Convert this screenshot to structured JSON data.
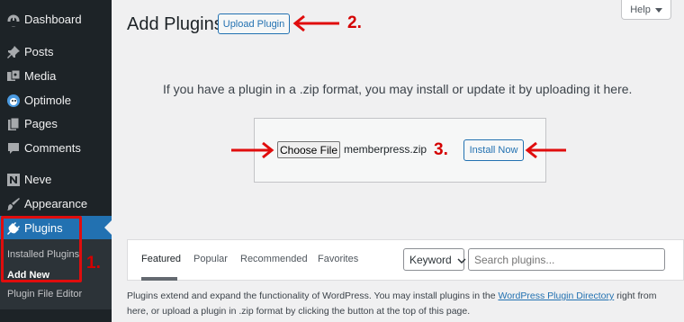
{
  "sidebar": {
    "items": [
      {
        "label": "Dashboard",
        "icon": "dashboard-icon"
      },
      {
        "label": "Posts",
        "icon": "pin-icon"
      },
      {
        "label": "Media",
        "icon": "media-icon"
      },
      {
        "label": "Optimole",
        "icon": "optimole-icon"
      },
      {
        "label": "Pages",
        "icon": "pages-icon"
      },
      {
        "label": "Comments",
        "icon": "comment-icon"
      },
      {
        "label": "Neve",
        "icon": "neve-icon"
      },
      {
        "label": "Appearance",
        "icon": "appearance-icon"
      },
      {
        "label": "Plugins",
        "icon": "plugins-icon"
      }
    ],
    "submenu": [
      "Installed Plugins",
      "Add New",
      "Plugin File Editor"
    ]
  },
  "header": {
    "title": "Add Plugins",
    "upload_button": "Upload Plugin",
    "help": "Help"
  },
  "upload": {
    "instructions": "If you have a plugin in a .zip format, you may install or update it by uploading it here.",
    "choose_button": "Choose File",
    "file_name": "memberpress.zip",
    "install_button": "Install Now"
  },
  "annotations": [
    "1.",
    "2.",
    "3."
  ],
  "filter": {
    "tabs": [
      "Featured",
      "Popular",
      "Recommended",
      "Favorites"
    ],
    "keyword": "Keyword",
    "search_placeholder": "Search plugins..."
  },
  "description": {
    "text_before": "Plugins extend and expand the functionality of WordPress. You may install plugins in the ",
    "link": "WordPress Plugin Directory",
    "text_after": " right from here, or upload a plugin in .zip format by clicking the button at the top of this page."
  },
  "colors": {
    "sidebar_bg": "#1d2327",
    "accent": "#2271b1",
    "annotation_red": "#e00d0d"
  }
}
